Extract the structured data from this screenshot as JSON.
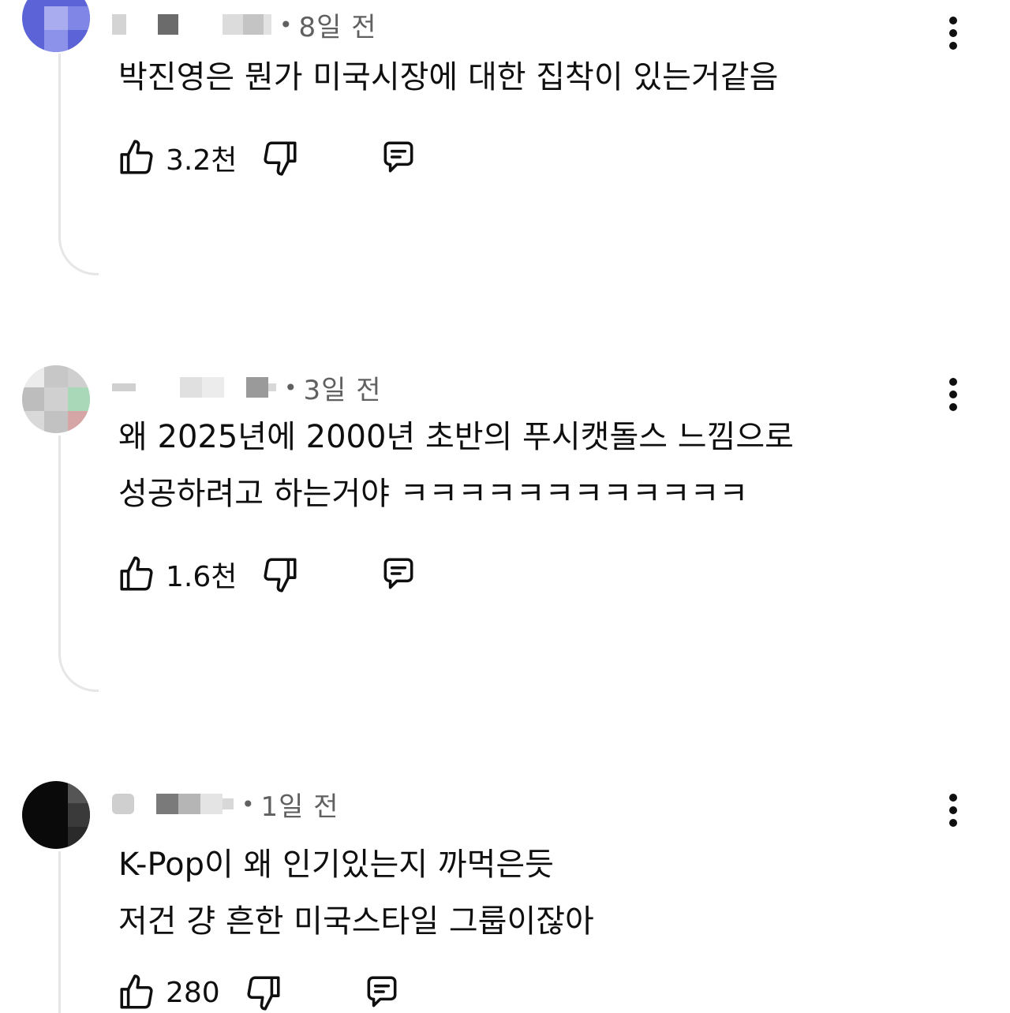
{
  "comments": [
    {
      "time": "8일 전",
      "text_lines": [
        "박진영은 뭔가 미국시장에 대한 집착이 있는거같음"
      ],
      "likes": "3.2천"
    },
    {
      "time": "3일 전",
      "text_lines": [
        "왜 2025년에 2000년 초반의 푸시캣돌스 느낌으로",
        "성공하려고 하는거야 ㅋㅋㅋㅋㅋㅋㅋㅋㅋㅋㅋㅋ"
      ],
      "likes": "1.6천"
    },
    {
      "time": "1일 전",
      "text_lines": [
        "K-Pop이 왜 인기있는지 까먹은듯",
        "저건 걍 흔한 미국스타일 그룹이잖아"
      ],
      "likes": "280"
    }
  ],
  "colors": {
    "text": "#0f0f0f",
    "meta": "#606060",
    "thread_line": "#e6e6e6"
  },
  "icons": {
    "like": "thumbs-up-icon",
    "dislike": "thumbs-down-icon",
    "reply": "reply-comment-icon",
    "more": "more-vertical-icon"
  }
}
